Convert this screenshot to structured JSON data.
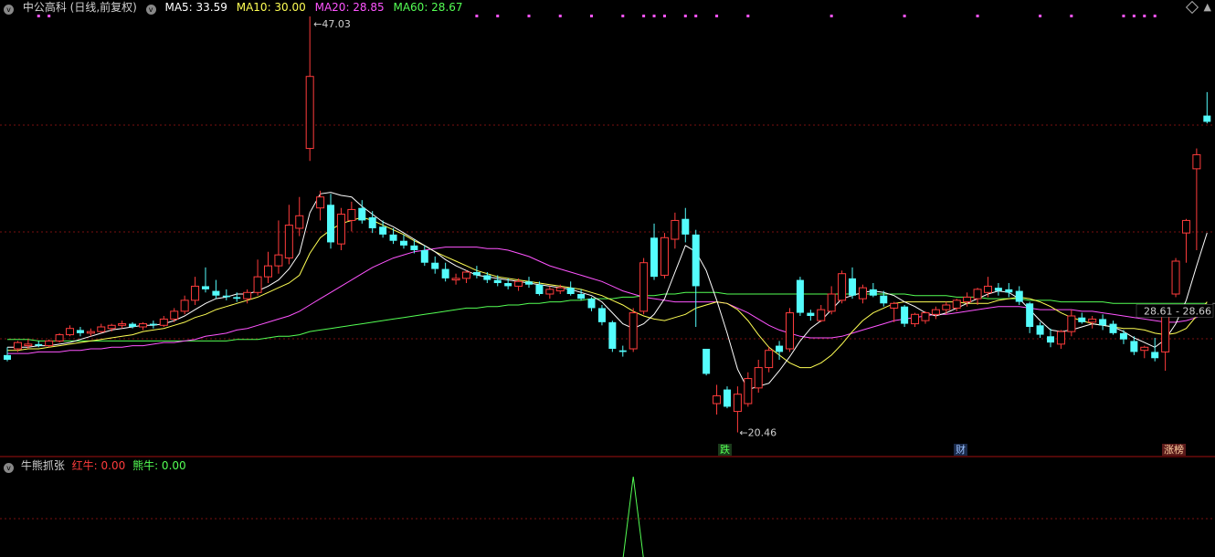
{
  "header": {
    "stock": "中公高科 (日线,前复权)",
    "ma5": "MA5: 33.59",
    "ma10": "MA10: 30.00",
    "ma20": "MA20: 28.85",
    "ma60": "MA60: 28.67"
  },
  "indicator": {
    "name": "牛熊抓张",
    "red": "红牛: 0.00",
    "green": "熊牛: 0.00"
  },
  "annotations": {
    "high": "47.03",
    "low": "20.46",
    "right_label": "28.61 - 28.66"
  },
  "tags": {
    "fall": "跌",
    "finance": "财",
    "limit": "涨榜"
  },
  "colors": {
    "up": "#ff3c3c",
    "down": "#54fcfc",
    "ma5": "#ffffff",
    "ma10": "#ffff54",
    "ma20": "#ff54ff",
    "ma60": "#54ff54",
    "grid": "#7a1010",
    "text": "#d0d0d0"
  },
  "chart_data": {
    "type": "candlestick",
    "ylim": [
      19.5,
      47.5
    ],
    "ohlc": [
      [
        25.4,
        25.9,
        25.0,
        25.1
      ],
      [
        25.8,
        26.3,
        25.6,
        26.2
      ],
      [
        26.0,
        26.4,
        25.8,
        26.1
      ],
      [
        26.1,
        26.3,
        25.9,
        26.0
      ],
      [
        26.0,
        26.4,
        25.9,
        26.3
      ],
      [
        26.3,
        26.8,
        26.2,
        26.7
      ],
      [
        26.7,
        27.3,
        26.6,
        27.1
      ],
      [
        27.0,
        27.2,
        26.6,
        26.8
      ],
      [
        26.8,
        27.1,
        26.6,
        26.9
      ],
      [
        26.9,
        27.4,
        26.8,
        27.2
      ],
      [
        27.1,
        27.4,
        26.9,
        27.3
      ],
      [
        27.3,
        27.6,
        27.1,
        27.4
      ],
      [
        27.4,
        27.5,
        27.1,
        27.2
      ],
      [
        27.2,
        27.5,
        27.0,
        27.4
      ],
      [
        27.4,
        27.6,
        27.1,
        27.3
      ],
      [
        27.3,
        27.9,
        27.2,
        27.7
      ],
      [
        27.7,
        28.4,
        27.5,
        28.2
      ],
      [
        28.2,
        29.2,
        28.0,
        28.9
      ],
      [
        28.9,
        30.4,
        28.6,
        29.8
      ],
      [
        29.8,
        31.0,
        29.4,
        29.6
      ],
      [
        29.5,
        30.2,
        29.0,
        29.2
      ],
      [
        29.2,
        29.6,
        28.9,
        29.1
      ],
      [
        29.1,
        29.4,
        28.8,
        29.0
      ],
      [
        29.0,
        29.6,
        28.7,
        29.4
      ],
      [
        29.4,
        31.5,
        29.2,
        30.4
      ],
      [
        30.4,
        32.0,
        30.0,
        31.1
      ],
      [
        31.1,
        34.0,
        30.6,
        31.8
      ],
      [
        31.6,
        35.0,
        31.2,
        33.7
      ],
      [
        33.5,
        35.5,
        33.0,
        34.3
      ],
      [
        38.6,
        47.03,
        37.8,
        43.2
      ],
      [
        34.8,
        35.9,
        34.0,
        35.5
      ],
      [
        35.0,
        35.7,
        32.2,
        32.6
      ],
      [
        32.5,
        34.8,
        32.1,
        34.4
      ],
      [
        34.0,
        35.2,
        33.3,
        34.7
      ],
      [
        34.8,
        35.3,
        33.8,
        34.0
      ],
      [
        34.2,
        34.6,
        33.2,
        33.5
      ],
      [
        33.6,
        34.0,
        32.9,
        33.1
      ],
      [
        33.1,
        33.5,
        32.5,
        32.7
      ],
      [
        32.7,
        33.1,
        32.2,
        32.4
      ],
      [
        32.4,
        32.8,
        31.9,
        32.1
      ],
      [
        32.1,
        32.4,
        31.1,
        31.3
      ],
      [
        31.3,
        31.7,
        30.6,
        30.9
      ],
      [
        30.9,
        31.3,
        30.1,
        30.3
      ],
      [
        30.2,
        30.6,
        29.9,
        30.3
      ],
      [
        30.3,
        30.8,
        30.0,
        30.7
      ],
      [
        30.7,
        31.1,
        30.3,
        30.5
      ],
      [
        30.5,
        30.7,
        30.0,
        30.2
      ],
      [
        30.2,
        30.5,
        29.8,
        30.0
      ],
      [
        30.0,
        30.3,
        29.6,
        29.8
      ],
      [
        29.8,
        30.3,
        29.5,
        30.1
      ],
      [
        30.1,
        30.4,
        29.7,
        29.9
      ],
      [
        29.9,
        30.1,
        29.2,
        29.3
      ],
      [
        29.3,
        29.8,
        29.0,
        29.6
      ],
      [
        29.5,
        29.9,
        29.3,
        29.7
      ],
      [
        29.7,
        30.1,
        29.2,
        29.3
      ],
      [
        29.3,
        29.6,
        28.9,
        29.0
      ],
      [
        29.0,
        29.1,
        28.2,
        28.4
      ],
      [
        28.4,
        28.6,
        27.3,
        27.5
      ],
      [
        27.5,
        27.6,
        25.6,
        25.8
      ],
      [
        25.7,
        26.0,
        25.3,
        25.6
      ],
      [
        25.8,
        28.4,
        25.6,
        28.1
      ],
      [
        28.2,
        31.6,
        28.0,
        31.3
      ],
      [
        32.9,
        33.8,
        30.2,
        30.4
      ],
      [
        30.5,
        33.2,
        30.3,
        32.9
      ],
      [
        32.8,
        34.5,
        32.2,
        34.0
      ],
      [
        34.1,
        34.8,
        32.6,
        33.1
      ],
      [
        33.1,
        33.4,
        27.2,
        29.8
      ],
      [
        25.8,
        25.8,
        24.1,
        24.2
      ],
      [
        22.3,
        23.5,
        21.6,
        22.8
      ],
      [
        23.2,
        23.4,
        22.0,
        22.1
      ],
      [
        21.8,
        23.4,
        20.46,
        22.9
      ],
      [
        22.3,
        24.3,
        22.1,
        23.9
      ],
      [
        23.3,
        25.1,
        23.0,
        24.6
      ],
      [
        24.6,
        25.9,
        24.3,
        25.7
      ],
      [
        26.0,
        26.3,
        25.1,
        25.6
      ],
      [
        25.8,
        28.4,
        25.6,
        28.1
      ],
      [
        30.2,
        30.4,
        27.9,
        28.1
      ],
      [
        28.1,
        28.3,
        27.6,
        27.9
      ],
      [
        27.6,
        28.6,
        27.5,
        28.3
      ],
      [
        28.2,
        29.8,
        28.0,
        29.3
      ],
      [
        28.9,
        30.8,
        28.7,
        30.6
      ],
      [
        30.3,
        31.0,
        29.0,
        29.2
      ],
      [
        29.0,
        29.9,
        28.7,
        29.7
      ],
      [
        29.6,
        30.0,
        29.1,
        29.2
      ],
      [
        29.2,
        29.5,
        28.5,
        28.7
      ],
      [
        28.4,
        28.8,
        27.5,
        28.7
      ],
      [
        28.5,
        28.6,
        27.2,
        27.4
      ],
      [
        27.4,
        28.1,
        27.2,
        28.0
      ],
      [
        27.6,
        28.2,
        27.4,
        28.1
      ],
      [
        28.0,
        28.5,
        27.7,
        28.3
      ],
      [
        28.3,
        28.8,
        28.0,
        28.6
      ],
      [
        28.4,
        29.0,
        28.2,
        28.9
      ],
      [
        28.8,
        29.4,
        28.5,
        29.1
      ],
      [
        29.0,
        29.7,
        28.6,
        29.6
      ],
      [
        29.4,
        30.4,
        29.1,
        29.8
      ],
      [
        29.7,
        30.0,
        29.2,
        29.5
      ],
      [
        29.6,
        30.0,
        29.1,
        29.4
      ],
      [
        29.5,
        29.8,
        28.6,
        28.8
      ],
      [
        28.7,
        28.8,
        26.8,
        27.2
      ],
      [
        27.3,
        27.5,
        26.5,
        26.7
      ],
      [
        26.6,
        27.1,
        25.9,
        26.2
      ],
      [
        26.1,
        27.0,
        25.8,
        26.9
      ],
      [
        26.9,
        28.3,
        26.6,
        27.9
      ],
      [
        27.8,
        28.1,
        27.4,
        27.5
      ],
      [
        27.5,
        27.9,
        27.1,
        27.7
      ],
      [
        27.7,
        28.0,
        27.0,
        27.3
      ],
      [
        27.4,
        27.6,
        26.7,
        26.8
      ],
      [
        26.8,
        27.0,
        26.1,
        26.4
      ],
      [
        26.3,
        26.6,
        25.4,
        25.6
      ],
      [
        25.7,
        26.0,
        25.2,
        25.9
      ],
      [
        25.6,
        26.5,
        25.0,
        25.2
      ],
      [
        25.6,
        28.6,
        24.4,
        28.6
      ],
      [
        29.3,
        31.6,
        29.1,
        31.4
      ],
      [
        33.2,
        34.1,
        31.3,
        34.0
      ],
      [
        37.3,
        38.6,
        32.1,
        38.2
      ],
      [
        40.7,
        42.2,
        40.2,
        40.3
      ]
    ],
    "ma5": [
      25.9,
      25.9,
      25.9,
      26.0,
      26.0,
      26.1,
      26.2,
      26.4,
      26.6,
      26.8,
      27.0,
      27.1,
      27.2,
      27.3,
      27.3,
      27.4,
      27.6,
      27.9,
      28.3,
      28.7,
      29.0,
      29.1,
      29.3,
      29.3,
      29.5,
      29.8,
      30.2,
      30.9,
      31.9,
      34.5,
      35.7,
      35.8,
      35.6,
      35.5,
      34.9,
      34.4,
      33.9,
      33.6,
      33.2,
      32.8,
      32.4,
      32.0,
      31.5,
      31.1,
      30.8,
      30.5,
      30.4,
      30.3,
      30.2,
      30.1,
      30.0,
      29.9,
      29.8,
      29.7,
      29.6,
      29.4,
      29.2,
      28.8,
      28.1,
      27.4,
      27.1,
      27.4,
      28.0,
      29.0,
      30.7,
      32.4,
      32.0,
      30.8,
      28.9,
      26.8,
      24.5,
      23.2,
      23.4,
      23.6,
      24.4,
      25.3,
      26.3,
      27.1,
      27.6,
      28.3,
      29.0,
      29.2,
      29.4,
      29.5,
      29.4,
      29.2,
      28.8,
      28.5,
      28.1,
      27.9,
      28.1,
      28.4,
      28.7,
      29.0,
      29.3,
      29.5,
      29.4,
      29.0,
      28.3,
      27.6,
      27.0,
      26.9,
      27.0,
      27.2,
      27.4,
      27.3,
      27.2,
      26.9,
      26.5,
      26.2,
      25.9,
      26.4,
      27.4,
      28.9,
      31.1,
      33.2
    ],
    "ma10": [
      25.7,
      25.7,
      25.8,
      25.8,
      25.9,
      26.0,
      26.1,
      26.2,
      26.3,
      26.4,
      26.5,
      26.6,
      26.7,
      26.9,
      27.0,
      27.1,
      27.3,
      27.5,
      27.8,
      28.0,
      28.3,
      28.5,
      28.7,
      28.9,
      29.1,
      29.4,
      29.7,
      30.0,
      30.5,
      31.9,
      32.9,
      33.4,
      33.8,
      34.0,
      34.2,
      34.0,
      33.7,
      33.4,
      33.1,
      32.7,
      32.4,
      32.0,
      31.7,
      31.4,
      31.1,
      30.8,
      30.6,
      30.4,
      30.3,
      30.2,
      30.1,
      30.0,
      29.9,
      29.8,
      29.7,
      29.6,
      29.4,
      29.2,
      28.9,
      28.6,
      28.2,
      27.9,
      27.7,
      27.6,
      27.8,
      28.0,
      28.4,
      28.6,
      28.8,
      28.7,
      28.3,
      27.6,
      26.7,
      25.9,
      25.4,
      24.9,
      24.6,
      24.6,
      24.9,
      25.4,
      26.1,
      26.9,
      27.6,
      28.1,
      28.4,
      28.7,
      28.8,
      28.8,
      28.8,
      28.8,
      28.8,
      28.8,
      28.7,
      28.7,
      28.7,
      28.9,
      29.0,
      29.1,
      29.0,
      28.8,
      28.5,
      28.1,
      27.8,
      27.6,
      27.4,
      27.3,
      27.2,
      27.1,
      27.1,
      27.0,
      26.8,
      26.7,
      26.8,
      27.1,
      27.9,
      28.8
    ],
    "ma20": [
      25.5,
      25.5,
      25.5,
      25.6,
      25.6,
      25.6,
      25.7,
      25.7,
      25.8,
      25.8,
      25.9,
      25.9,
      26.0,
      26.0,
      26.1,
      26.2,
      26.2,
      26.3,
      26.4,
      26.6,
      26.7,
      26.8,
      27.0,
      27.1,
      27.3,
      27.5,
      27.7,
      27.9,
      28.2,
      28.6,
      29.0,
      29.4,
      29.8,
      30.2,
      30.6,
      31.0,
      31.3,
      31.6,
      31.8,
      32.0,
      32.1,
      32.2,
      32.3,
      32.3,
      32.3,
      32.3,
      32.2,
      32.2,
      32.1,
      31.9,
      31.7,
      31.4,
      31.1,
      30.9,
      30.7,
      30.5,
      30.3,
      30.1,
      29.8,
      29.5,
      29.3,
      29.1,
      29.0,
      28.9,
      28.8,
      28.8,
      28.8,
      28.8,
      28.8,
      28.7,
      28.4,
      28.1,
      27.7,
      27.3,
      27.0,
      26.8,
      26.6,
      26.5,
      26.5,
      26.5,
      26.6,
      26.8,
      27.0,
      27.2,
      27.4,
      27.6,
      27.7,
      27.8,
      27.9,
      28.0,
      28.0,
      28.1,
      28.2,
      28.3,
      28.4,
      28.5,
      28.5,
      28.5,
      28.4,
      28.3,
      28.3,
      28.3,
      28.3,
      28.2,
      28.2,
      28.1,
      28.0,
      27.9,
      27.8,
      27.7,
      27.6,
      27.5,
      27.5,
      27.6,
      27.8,
      28.1
    ],
    "ma60": [
      26.4,
      26.4,
      26.4,
      26.3,
      26.3,
      26.3,
      26.3,
      26.3,
      26.3,
      26.3,
      26.3,
      26.3,
      26.3,
      26.3,
      26.3,
      26.3,
      26.3,
      26.3,
      26.3,
      26.3,
      26.3,
      26.3,
      26.4,
      26.4,
      26.4,
      26.5,
      26.6,
      26.6,
      26.7,
      26.9,
      27.0,
      27.1,
      27.2,
      27.3,
      27.4,
      27.5,
      27.6,
      27.7,
      27.8,
      27.9,
      28.0,
      28.1,
      28.2,
      28.3,
      28.4,
      28.4,
      28.5,
      28.5,
      28.6,
      28.6,
      28.7,
      28.7,
      28.8,
      28.8,
      28.9,
      28.9,
      29.0,
      29.0,
      29.0,
      29.1,
      29.1,
      29.2,
      29.2,
      29.3,
      29.3,
      29.4,
      29.4,
      29.4,
      29.4,
      29.3,
      29.3,
      29.3,
      29.3,
      29.3,
      29.3,
      29.3,
      29.3,
      29.3,
      29.3,
      29.3,
      29.3,
      29.3,
      29.3,
      29.3,
      29.3,
      29.3,
      29.3,
      29.2,
      29.2,
      29.2,
      29.2,
      29.1,
      29.1,
      29.1,
      29.0,
      29.0,
      29.0,
      29.0,
      28.9,
      28.9,
      28.9,
      28.8,
      28.8,
      28.8,
      28.8,
      28.8,
      28.7,
      28.7,
      28.7,
      28.7,
      28.7,
      28.7,
      28.7,
      28.7,
      28.7,
      28.7
    ],
    "top_markers": [
      3,
      4,
      45,
      47,
      50,
      53,
      56,
      59,
      61,
      62,
      63,
      65,
      66,
      68,
      71,
      79,
      86,
      93,
      99,
      102,
      107,
      108,
      109,
      110
    ],
    "indicator_spike_index": 60
  }
}
